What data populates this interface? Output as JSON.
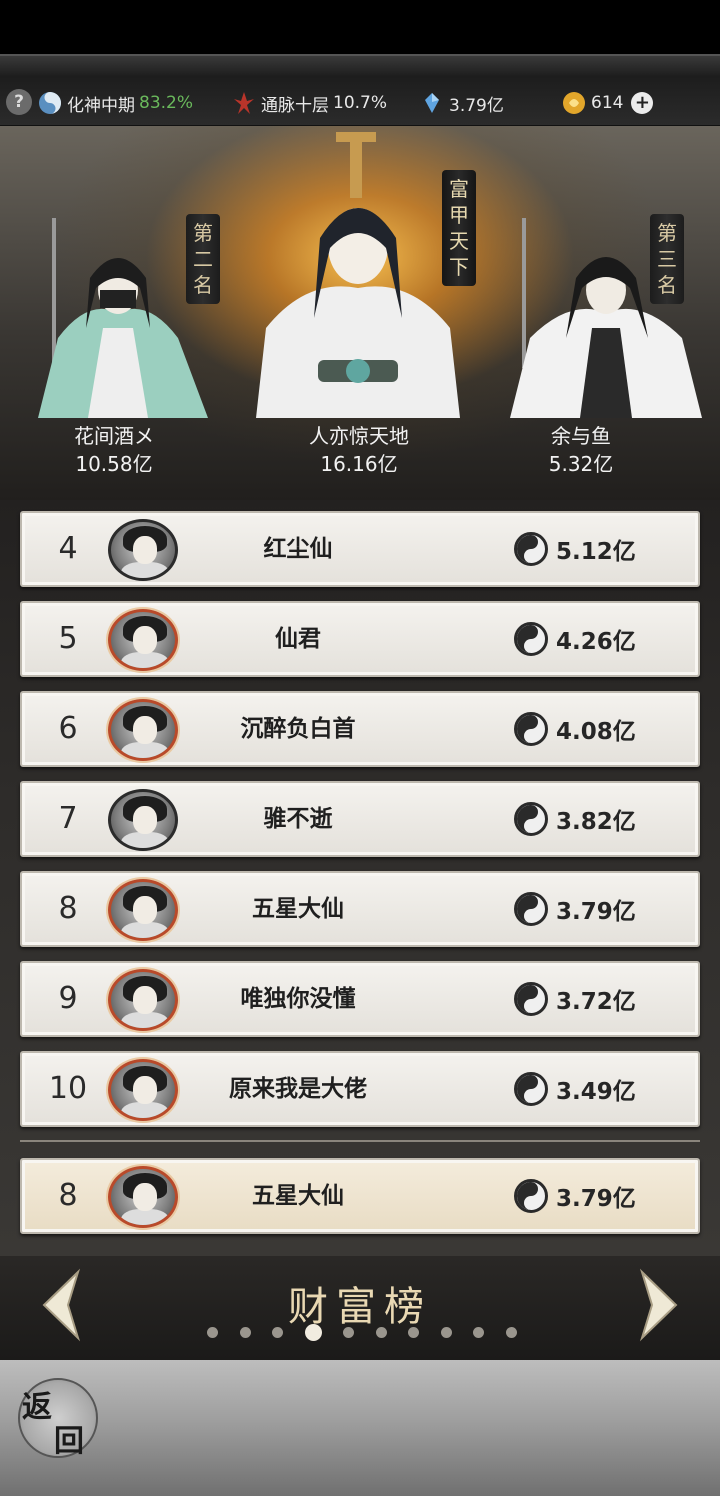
{
  "status_bar": {
    "help": "?",
    "realm_name": "化神中期",
    "realm_progress": "83.2%",
    "meridian_name": "通脉十层",
    "meridian_progress": "10.7%",
    "crystal_value": "3.79亿",
    "coin_value": "614",
    "plus": "+"
  },
  "podium": {
    "title_tag": "富甲天下",
    "second_tag": "第二名",
    "third_tag": "第三名",
    "first": {
      "name": "人亦惊天地",
      "value": "16.16亿"
    },
    "second": {
      "name": "花间酒メ",
      "value": "10.58亿"
    },
    "third": {
      "name": "余与鱼",
      "value": "5.32亿"
    }
  },
  "ranking": [
    {
      "rank": "4",
      "name": "红尘仙",
      "value": "5.12亿"
    },
    {
      "rank": "5",
      "name": "仙君",
      "value": "4.26亿"
    },
    {
      "rank": "6",
      "name": "沉醉负白首",
      "value": "4.08亿"
    },
    {
      "rank": "7",
      "name": "骓不逝",
      "value": "3.82亿"
    },
    {
      "rank": "8",
      "name": "五星大仙",
      "value": "3.79亿"
    },
    {
      "rank": "9",
      "name": "唯独你没懂",
      "value": "3.72亿"
    },
    {
      "rank": "10",
      "name": "原来我是大佬",
      "value": "3.49亿"
    }
  ],
  "my_rank": {
    "rank": "8",
    "name": "五星大仙",
    "value": "3.79亿"
  },
  "footer": {
    "title": "财富榜",
    "page_count": 10,
    "active_page": 4
  },
  "back_button": {
    "char1": "返",
    "char2": "回"
  },
  "colors": {
    "progress_green": "#6ab95c",
    "footer_gold": "#e9d8b3"
  }
}
